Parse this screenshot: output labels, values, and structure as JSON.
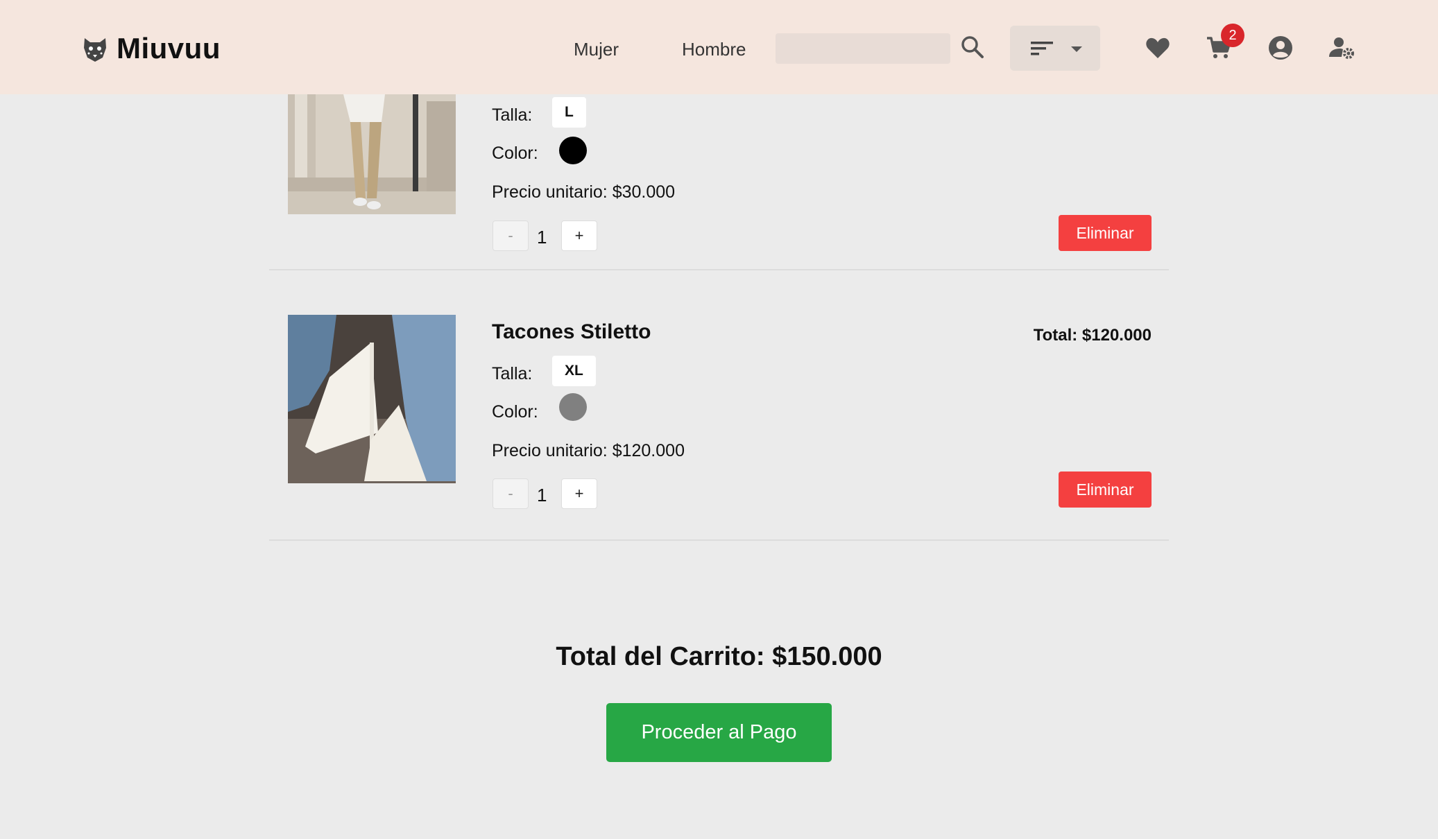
{
  "header": {
    "brand": "Miuvuu",
    "nav": [
      "Mujer",
      "Hombre"
    ],
    "search": {
      "value": "",
      "placeholder": ""
    },
    "cart_count": "2"
  },
  "items": [
    {
      "name": "",
      "total": "",
      "talla_label": "Talla:",
      "talla": "L",
      "color_label": "Color:",
      "color": "#000000",
      "precio_unitario": "Precio unitario: $30.000",
      "qty_minus": "-",
      "qty": "1",
      "qty_plus": "+",
      "delete_label": "Eliminar"
    },
    {
      "name": "Tacones Stiletto",
      "total": "Total: $120.000",
      "talla_label": "Talla:",
      "talla": "XL",
      "color_label": "Color:",
      "color": "#808080",
      "precio_unitario": "Precio unitario: $120.000",
      "qty_minus": "-",
      "qty": "1",
      "qty_plus": "+",
      "delete_label": "Eliminar"
    }
  ],
  "summary": {
    "cart_total": "Total del Carrito: $150.000",
    "checkout_label": "Proceder al Pago"
  },
  "colors": {
    "header_bg": "#f5e6de",
    "page_bg": "#ebebeb",
    "delete": "#f44040",
    "checkout": "#27a745",
    "badge": "#d9262b"
  },
  "icons": [
    "leopard-logo-icon",
    "search-icon",
    "sort-icon",
    "chevron-down-icon",
    "heart-icon",
    "cart-icon",
    "user-icon",
    "user-settings-icon"
  ]
}
